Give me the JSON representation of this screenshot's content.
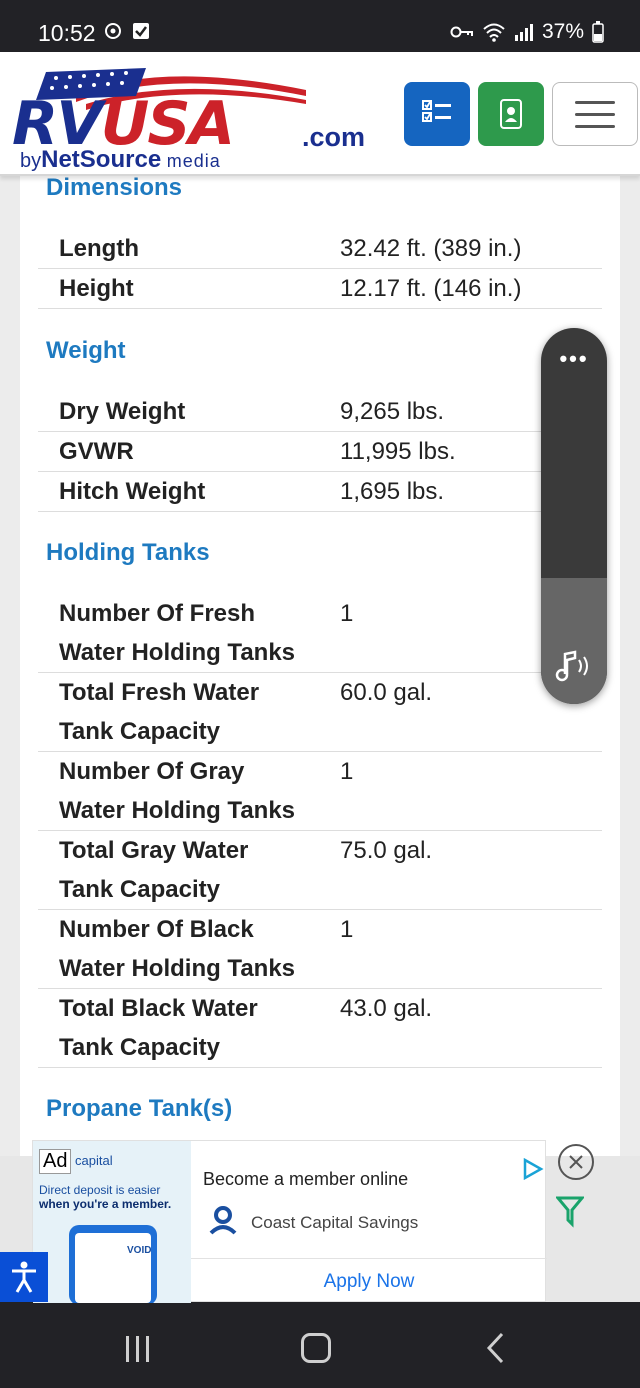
{
  "status_bar": {
    "time": "10:52",
    "battery": "37%",
    "icons": [
      "signal-strength-icon",
      "check-square-icon",
      "vpn-key-icon",
      "wifi-icon",
      "cell-signal-icon",
      "battery-icon"
    ]
  },
  "header": {
    "logo": {
      "main_blue": "RV",
      "main_red": "USA",
      "dot_com": ".com",
      "by": "by",
      "brand": "NetSource",
      "media": "media"
    },
    "buttons": [
      "list-icon",
      "contact-card-icon",
      "hamburger-menu-icon"
    ],
    "colors": {
      "list_button": "#1565c0",
      "contact_button": "#2e9a4c",
      "heading": "#1e7ac0"
    }
  },
  "sections": {
    "dimensions": {
      "heading": "Dimensions",
      "rows": [
        {
          "label": "Length",
          "value": "32.42 ft. (389 in.)"
        },
        {
          "label": "Height",
          "value": "12.17 ft. (146 in.)"
        }
      ]
    },
    "weight": {
      "heading": "Weight",
      "rows": [
        {
          "label": "Dry Weight",
          "value": "9,265 lbs."
        },
        {
          "label": "GVWR",
          "value": "11,995 lbs."
        },
        {
          "label": "Hitch Weight",
          "value": "1,695 lbs."
        }
      ]
    },
    "holding_tanks": {
      "heading": "Holding Tanks",
      "rows": [
        {
          "label_1": "Number Of Fresh",
          "label_2": "Water Holding Tanks",
          "value": "1"
        },
        {
          "label_1": "Total Fresh Water",
          "label_2": "Tank Capacity",
          "value": "60.0 gal."
        },
        {
          "label_1": "Number Of Gray",
          "label_2": "Water Holding Tanks",
          "value": "1"
        },
        {
          "label_1": "Total Gray Water",
          "label_2": "Tank Capacity",
          "value": "75.0 gal."
        },
        {
          "label_1": "Number Of Black",
          "label_2": "Water Holding Tanks",
          "value": "1"
        },
        {
          "label_1": "Total Black Water",
          "label_2": "Tank Capacity",
          "value": "43.0 gal."
        }
      ]
    },
    "propane": {
      "heading": "Propane Tank(s)"
    }
  },
  "audio_widget": {
    "menu_glyph": "•••",
    "icon": "music-note-icon"
  },
  "ad": {
    "badge": "Ad",
    "brand_fragment": "capital",
    "tagline_1": "Direct deposit is easier",
    "tagline_2": "when you're a member.",
    "void_text": "VOID",
    "title": "Become a member online",
    "advertiser": "Coast Capital Savings",
    "cta": "Apply Now"
  },
  "nav_bar": {
    "icons": [
      "recent-apps-icon",
      "home-icon",
      "back-icon"
    ]
  }
}
